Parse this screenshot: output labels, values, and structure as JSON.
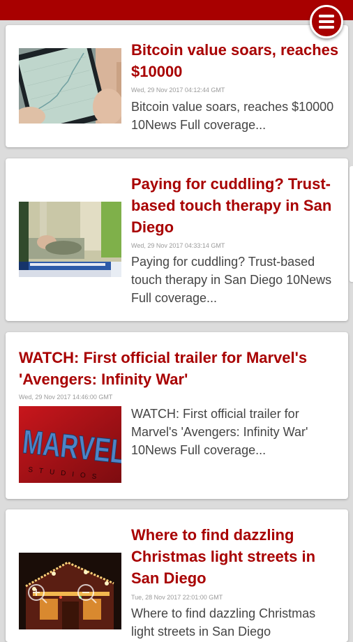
{
  "app": {
    "menu_icon": "hamburger-menu-icon",
    "accent_color": "#a80000"
  },
  "articles": [
    {
      "title": "Bitcoin value soars, reaches $10000",
      "date": "Wed, 29 Nov 2017 04:12:44 GMT",
      "description": "Bitcoin value soars, reaches $10000  10News  Full coverage...",
      "image": "phone-bitcoin-chart-image"
    },
    {
      "title": "Paying for cuddling? Trust-based touch therapy in San Diego",
      "date": "Wed, 29 Nov 2017 04:33:14 GMT",
      "description": "Paying for cuddling? Trust-based touch therapy in San Diego  10News  Full coverage...",
      "image": "cuddle-therapy-news-still-image"
    },
    {
      "title": "WATCH: First official trailer for Marvel's 'Avengers: Infinity War'",
      "date": "Wed, 29 Nov 2017 14:46:00 GMT",
      "description": "WATCH: First official trailer for Marvel's 'Avengers: Infinity War'  10News  Full coverage...",
      "image": "marvel-studios-logo-image",
      "image_text": "MARVEL",
      "image_subtext": "STUDIOS"
    },
    {
      "title": "Where to find dazzling Christmas light streets in San Diego",
      "date": "Tue, 28 Nov 2017 22:01:00 GMT",
      "description": "Where to find dazzling Christmas light streets in San Diego",
      "image": "christmas-lights-house-image"
    }
  ]
}
